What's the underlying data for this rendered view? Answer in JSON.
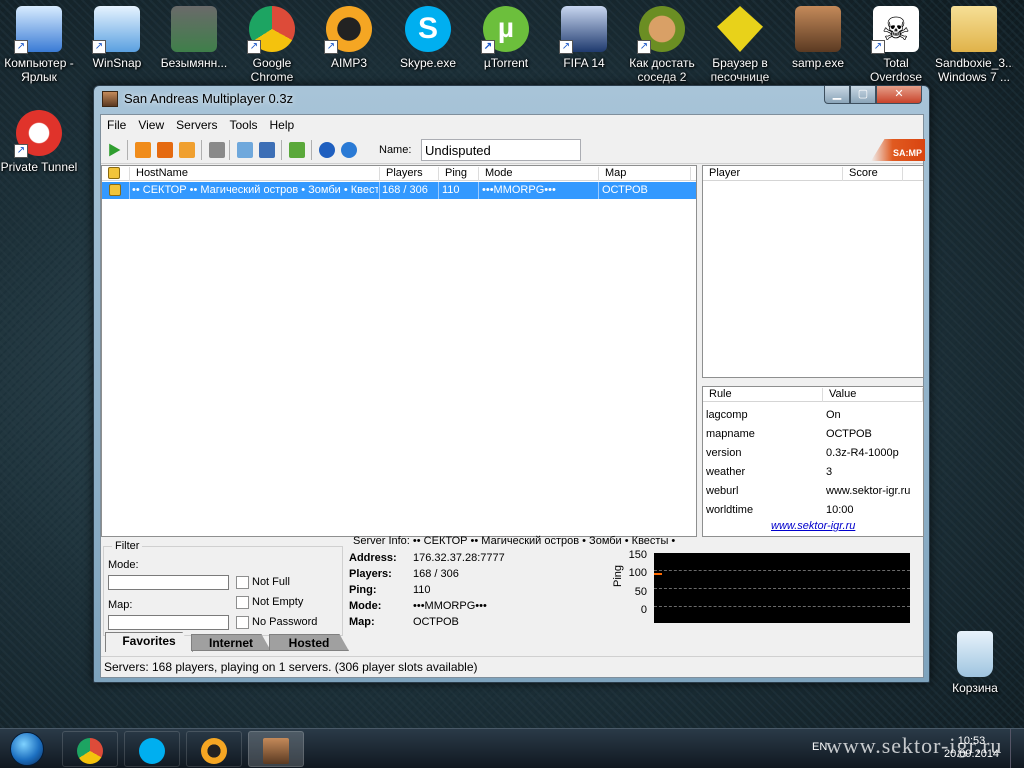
{
  "desktop": {
    "icons": [
      {
        "label": "Компьютер - Ярлык",
        "icon": "computer-icon",
        "color": "#3a7bd5"
      },
      {
        "label": "WinSnap",
        "icon": "winsnap-icon",
        "color": "#5aa0e0"
      },
      {
        "label": "Безымянн...",
        "icon": "image-file-icon",
        "color": "#3f7f4a"
      },
      {
        "label": "Google Chrome",
        "icon": "chrome-icon",
        "color": "#dd4b39"
      },
      {
        "label": "AIMP3",
        "icon": "aimp-icon",
        "color": "#f5a623"
      },
      {
        "label": "Skype.exe",
        "icon": "skype-icon",
        "color": "#00aff0"
      },
      {
        "label": "µTorrent",
        "icon": "utorrent-icon",
        "color": "#6cbf3c"
      },
      {
        "label": "FIFA 14",
        "icon": "fifa-icon",
        "color": "#1f3a6e"
      },
      {
        "label": "Как достать соседа 2",
        "icon": "game-neighbor-icon",
        "color": "#6b8e23"
      },
      {
        "label": "Браузер в песочнице",
        "icon": "sandbox-browser-icon",
        "color": "#e8d21a"
      },
      {
        "label": "samp.exe",
        "icon": "samp-icon",
        "color": "#8b5a2b"
      },
      {
        "label": "Total Overdose",
        "icon": "skull-icon",
        "color": "#eeeeee"
      },
      {
        "label": "Sandboxie_3... Windows 7 ...",
        "icon": "folder-icon",
        "color": "#e8c66a"
      },
      {
        "label": "Private Tunnel",
        "icon": "private-tunnel-icon",
        "color": "#e0332b"
      },
      {
        "label": "Корзина",
        "icon": "recycle-bin-icon",
        "color": "#9fc4e0"
      }
    ]
  },
  "window": {
    "title": "San Andreas Multiplayer 0.3z",
    "menu": [
      "File",
      "View",
      "Servers",
      "Tools",
      "Help"
    ],
    "toolbar": {
      "name_label": "Name:",
      "name_value": "Undisputed",
      "logo": "SA:MP"
    },
    "server_list": {
      "columns": [
        "HostName",
        "Players",
        "Ping",
        "Mode",
        "Map"
      ],
      "rows": [
        {
          "hostname": "•• СЕКТОР •• Магический остров • Зомби • Квесты •",
          "players": "168 / 306",
          "ping": "110",
          "mode": "•••MMORPG•••",
          "map": "ОСТРОВ"
        }
      ]
    },
    "players_panel": {
      "columns": [
        "Player",
        "Score"
      ]
    },
    "rules_panel": {
      "columns": [
        "Rule",
        "Value"
      ],
      "rows": [
        {
          "rule": "lagcomp",
          "value": "On"
        },
        {
          "rule": "mapname",
          "value": "ОСТРОВ"
        },
        {
          "rule": "version",
          "value": "0.3z-R4-1000p"
        },
        {
          "rule": "weather",
          "value": "3"
        },
        {
          "rule": "weburl",
          "value": "www.sektor-igr.ru"
        },
        {
          "rule": "worldtime",
          "value": "10:00"
        }
      ],
      "link": "www.sektor-igr.ru"
    },
    "filter": {
      "legend": "Filter",
      "mode_label": "Mode:",
      "mode_value": "",
      "map_label": "Map:",
      "map_value": "",
      "not_full": "Not Full",
      "not_empty": "Not Empty",
      "no_password": "No Password"
    },
    "server_info": {
      "header": "Server Info: •• СЕКТОР •• Магический остров • Зомби • Квесты •",
      "address_label": "Address:",
      "address": "176.32.37.28:7777",
      "players_label": "Players:",
      "players": "168 / 306",
      "ping_label": "Ping:",
      "ping": "110",
      "mode_label": "Mode:",
      "mode": "•••MMORPG•••",
      "map_label": "Map:",
      "map": "ОСТРОВ"
    },
    "ping_graph": {
      "axis_title": "Ping",
      "ticks": [
        "150",
        "100",
        "50",
        "0"
      ],
      "current": 110,
      "max": 150,
      "line_color": "#ff6a00"
    },
    "tabs": [
      "Favorites",
      "Internet",
      "Hosted"
    ],
    "active_tab": "Favorites",
    "status": "Servers: 168 players, playing on 1 servers. (306 player slots available)"
  },
  "taskbar": {
    "apps": [
      "chrome-icon",
      "skype-icon",
      "aimp-icon",
      "samp-icon"
    ],
    "lang": "EN",
    "time": "10:53",
    "date": "20.09.2014"
  },
  "watermark": "www.sektor-igr.ru"
}
